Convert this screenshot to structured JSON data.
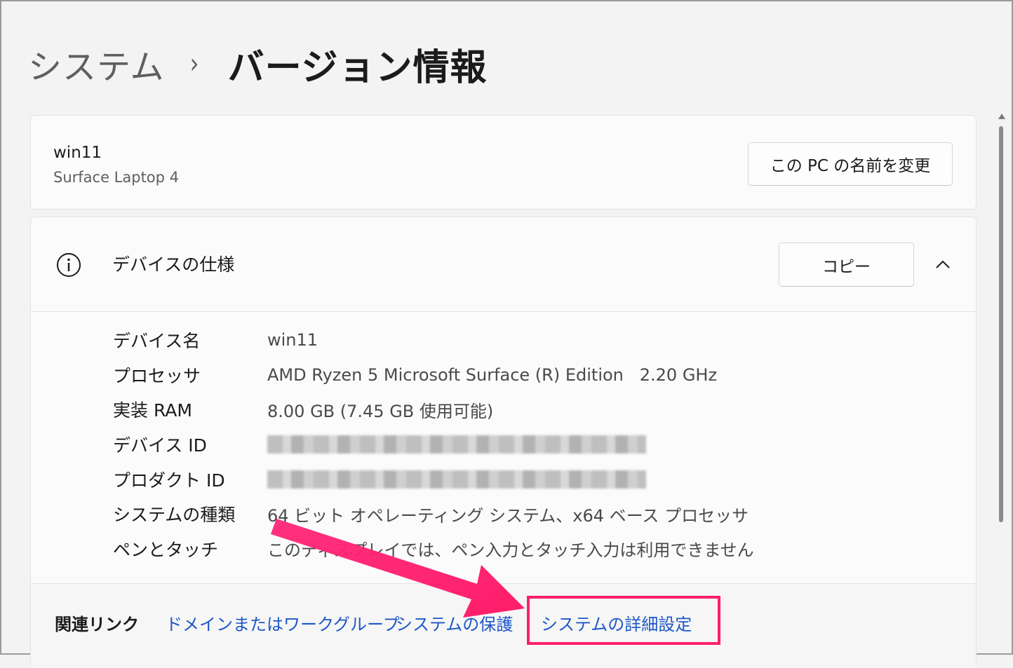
{
  "breadcrumb": {
    "parent": "システム",
    "separator": "›",
    "current": "バージョン情報"
  },
  "pc_card": {
    "name": "win11",
    "model": "Surface Laptop 4",
    "rename_button": "この PC の名前を変更"
  },
  "specs": {
    "title": "デバイスの仕様",
    "copy_button": "コピー",
    "rows": [
      {
        "label": "デバイス名",
        "value": "win11"
      },
      {
        "label": "プロセッサ",
        "value": "AMD Ryzen 5 Microsoft Surface (R) Edition   2.20 GHz"
      },
      {
        "label": "実装 RAM",
        "value": "8.00 GB (7.45 GB 使用可能)"
      },
      {
        "label": "デバイス ID",
        "value": ""
      },
      {
        "label": "プロダクト ID",
        "value": ""
      },
      {
        "label": "システムの種類",
        "value": "64 ビット オペレーティング システム、x64 ベース プロセッサ"
      },
      {
        "label": "ペンとタッチ",
        "value": "このディスプレイでは、ペン入力とタッチ入力は利用できません"
      }
    ]
  },
  "related": {
    "title": "関連リンク",
    "links": [
      "ドメインまたはワークグループ",
      "システムの保護",
      "システムの詳細設定"
    ]
  },
  "colors": {
    "accent_link": "#1d57c7",
    "highlight": "#ff1f6b",
    "background": "#f3f3f3"
  }
}
